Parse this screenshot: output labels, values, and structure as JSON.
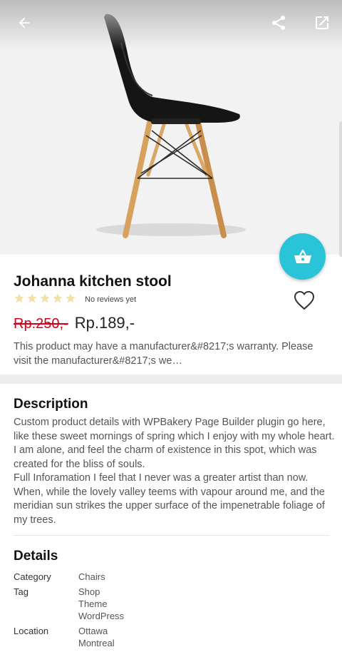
{
  "topbar": {
    "back_icon": "arrow-left-icon",
    "share_icon": "share-icon",
    "open_external_icon": "open-external-icon"
  },
  "product": {
    "image": "black-chair-wooden-legs",
    "title": "Johanna kitchen stool",
    "rating": 0,
    "rating_max": 5,
    "reviews_text": "No reviews yet",
    "price_old": "Rp.250,-",
    "price_new": "Rp.189,-",
    "short_description": "This product may have a manufacturer&#8217;s warranty. Please visit the manufacturer&#8217;s we…",
    "cart_icon": "basket-icon",
    "wishlist_icon": "heart-outline-icon"
  },
  "description": {
    "title": "Description",
    "para1": "Custom product details with WPBakery Page Builder plugin go here, like these sweet mornings of spring which I enjoy with my whole heart. I am alone, and feel the charm of existence in this spot, which was created for the bliss of souls.",
    "para2": "Full Inforamation I feel that I never was a greater artist than now. When, while the lovely valley teems with vapour around me, and the meridian sun strikes the upper surface of the impenetrable foliage of my trees."
  },
  "details": {
    "title": "Details",
    "category_label": "Category",
    "category_value": "Chairs",
    "tag_label": "Tag",
    "tags": [
      "Shop",
      "Theme",
      "WordPress"
    ],
    "location_label": "Location",
    "locations": [
      "Ottawa",
      "Montreal"
    ]
  },
  "colors": {
    "accent": "#29c4d7",
    "price_old": "#d0021b",
    "star_empty": "#f3e0a6"
  }
}
